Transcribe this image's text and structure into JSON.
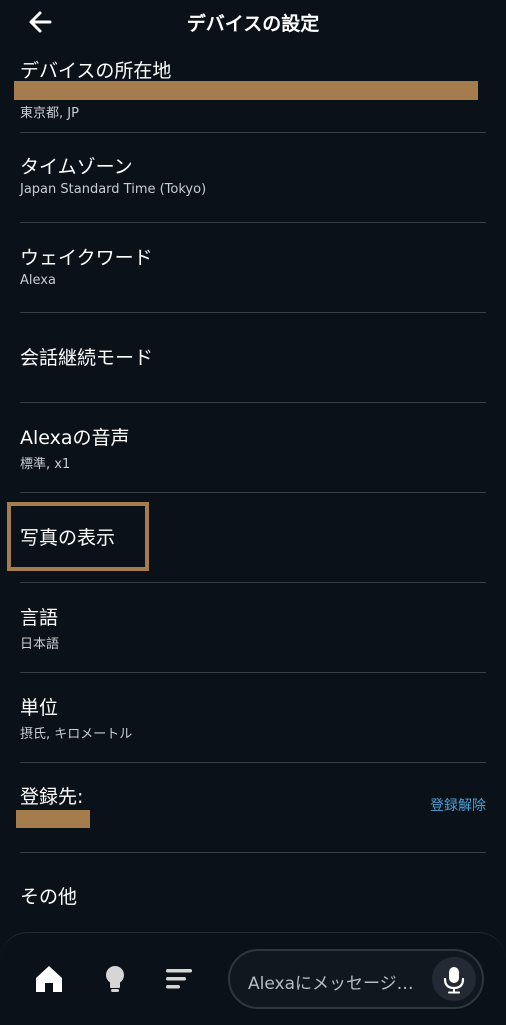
{
  "header": {
    "title": "デバイスの設定"
  },
  "settings": {
    "location": {
      "title": "デバイスの所在地",
      "value": "東京都, JP"
    },
    "timezone": {
      "title": "タイムゾーン",
      "value": "Japan Standard Time (Tokyo)"
    },
    "wakeword": {
      "title": "ウェイクワード",
      "value": "Alexa"
    },
    "follow_up": {
      "title": "会話継続モード"
    },
    "voice": {
      "title": "Alexaの音声",
      "value": "標準, x1"
    },
    "photos": {
      "title": "写真の表示"
    },
    "language": {
      "title": "言語",
      "value": "日本語"
    },
    "units": {
      "title": "単位",
      "value": "摂氏, キロメートル"
    },
    "registered": {
      "title": "登録先:",
      "action": "登録解除"
    },
    "other": {
      "title": "その他"
    }
  },
  "bottom_nav": {
    "items": [
      "home-icon",
      "lightbulb-icon",
      "list-icon"
    ],
    "message_placeholder": "Alexaにメッセージ…"
  },
  "colors": {
    "background": "#0b1118",
    "annotation": "#a57d4c",
    "link": "#47a2d6",
    "divider": "#3a3f46"
  }
}
